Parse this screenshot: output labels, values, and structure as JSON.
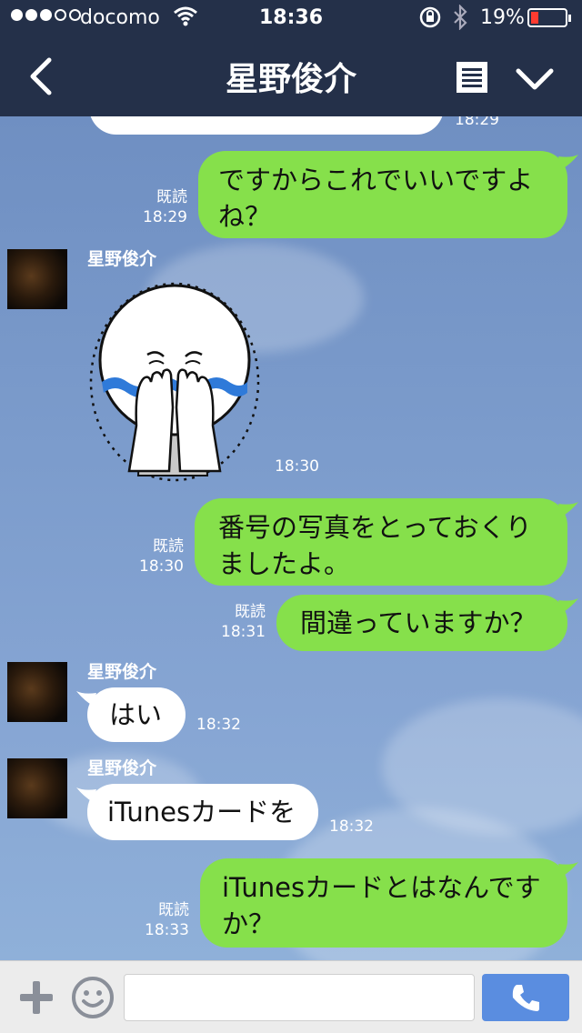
{
  "status_bar": {
    "carrier": "docomo",
    "time": "18:36",
    "battery_percent": "19%",
    "signal_bars_filled": 3,
    "signal_bars_total": 5,
    "battery_level": 0.19,
    "battery_color": "#ff3b30"
  },
  "header": {
    "title": "星野俊介",
    "background": "#243049",
    "icons": [
      "chevron-left-icon",
      "notes-icon",
      "chevron-down-icon"
    ]
  },
  "messages": [
    {
      "side": "in",
      "partial": true,
      "text": "…",
      "time": "18:29"
    },
    {
      "side": "out",
      "read": "既読",
      "time": "18:29",
      "lines": [
        "ですからこれでいいですよ",
        "ね？"
      ]
    },
    {
      "side": "in",
      "sender": "星野俊介",
      "sticker": "crying-face-sticker",
      "time": "18:30"
    },
    {
      "side": "out",
      "read": "既読",
      "time": "18:30",
      "lines": [
        "番号の写真をとっておくり",
        "ましたよ。"
      ]
    },
    {
      "side": "out",
      "read": "既読",
      "time": "18:31",
      "lines": [
        "間違っていますか？"
      ]
    },
    {
      "side": "in",
      "sender": "星野俊介",
      "time": "18:32",
      "lines": [
        "はい"
      ]
    },
    {
      "side": "in",
      "sender": "星野俊介",
      "time": "18:32",
      "lines": [
        "iTunesカードを"
      ]
    },
    {
      "side": "out",
      "read": "既読",
      "time": "18:33",
      "lines": [
        "iTunesカードとはなんです",
        "か？"
      ]
    }
  ],
  "input_bar": {
    "placeholder": "",
    "icons": [
      "plus-icon",
      "emoji-icon",
      "phone-icon"
    ]
  },
  "colors": {
    "outgoing_bubble": "#86e04b",
    "incoming_bubble": "#ffffff",
    "call_button": "#5a8de0"
  }
}
